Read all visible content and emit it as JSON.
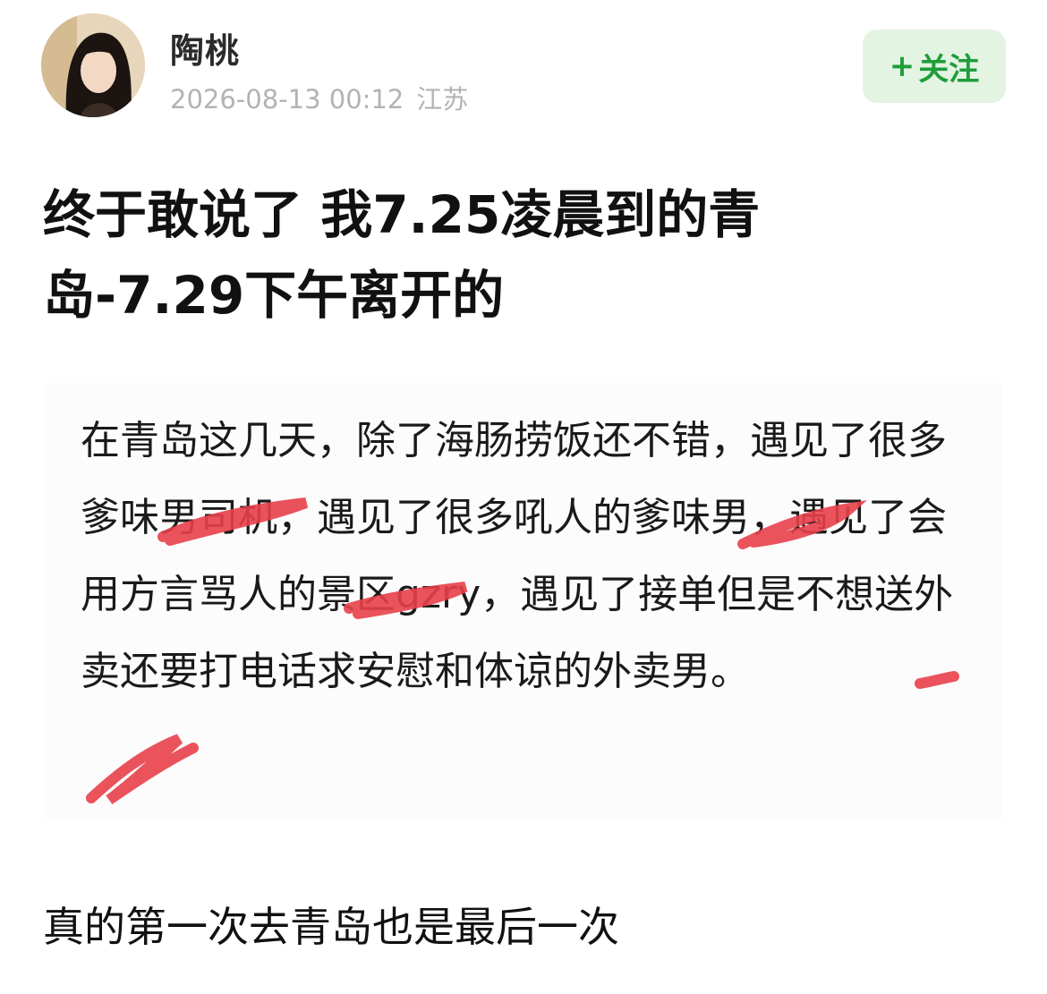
{
  "author": {
    "name": "陶桃",
    "timestamp": "2026-08-13 00:12",
    "location": "江苏",
    "avatar_icon": "user-avatar-photo"
  },
  "follow": {
    "plus": "+",
    "label": "关注",
    "bg_color": "#e3f4e3",
    "text_color": "#1f9d3a"
  },
  "post": {
    "title": "终于敢说了 我7.25凌晨到的青岛-7.29下午离开的",
    "quoted_text": "在青岛这几天，除了海肠捞饭还不错，遇见了很多爹味男司机，遇见了很多吼人的爹味男，遇见了会用方言骂人的景区gzry，遇见了接单但是不想送外卖还要打电话求安慰和体谅的外卖男。",
    "closing": "真的第一次去青岛也是最后一次",
    "scribble_color": "#e8404a"
  }
}
